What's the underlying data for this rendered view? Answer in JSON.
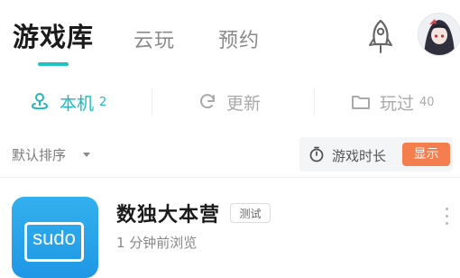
{
  "top_tabs": {
    "main": "游戏库",
    "cloud": "云玩",
    "reserve": "预约"
  },
  "filters": {
    "local": {
      "label": "本机",
      "count": "2"
    },
    "update": {
      "label": "更新"
    },
    "played": {
      "label": "玩过",
      "count": "40"
    }
  },
  "sort": {
    "label": "默认排序",
    "playtime_label": "游戏时长",
    "show_button": "显示"
  },
  "game": {
    "icon_text": "sudo",
    "title": "数独大本营",
    "badge": "测试",
    "subtitle": "1 分钟前浏览"
  },
  "colors": {
    "accent": "#21c2c6",
    "show_button_bg": "#f57e4f",
    "game_icon_bg": "#1f97e5"
  }
}
